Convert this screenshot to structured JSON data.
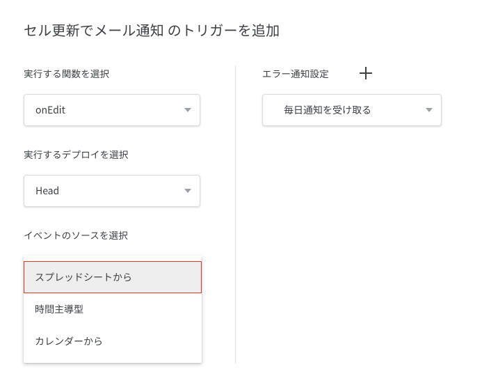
{
  "title": "セル更新でメール通知 のトリガーを追加",
  "left": {
    "function": {
      "label": "実行する関数を選択",
      "value": "onEdit"
    },
    "deploy": {
      "label": "実行するデプロイを選択",
      "value": "Head"
    },
    "event_source": {
      "label": "イベントのソースを選択",
      "options": [
        "スプレッドシートから",
        "時間主導型",
        "カレンダーから"
      ]
    }
  },
  "right": {
    "error_label": "エラー通知設定",
    "notify_value": "毎日通知を受け取る"
  }
}
